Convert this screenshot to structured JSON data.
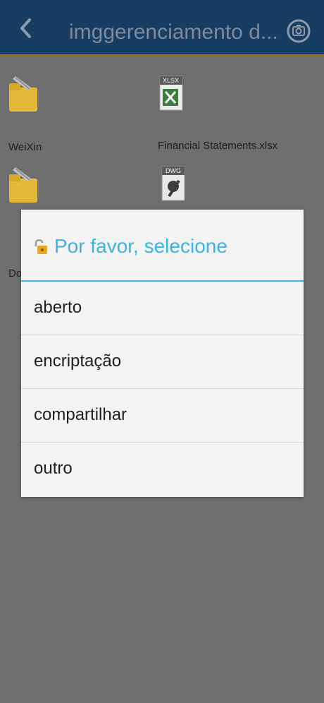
{
  "app_bar": {
    "title": "imggerenciamento d..."
  },
  "files": [
    {
      "name": "WeiXin",
      "icon": "folder-icon"
    },
    {
      "name": "Financial Statements.xlsx",
      "icon": "xlsx-file-icon",
      "badge": "XLSX"
    },
    {
      "name": "Do",
      "icon": "folder-icon"
    },
    {
      "name": "",
      "icon": "dwg-file-icon",
      "badge": "DWG"
    }
  ],
  "dialog": {
    "title": "Por favor, selecione",
    "options": [
      {
        "label": "aberto"
      },
      {
        "label": "encriptação"
      },
      {
        "label": "compartilhar"
      },
      {
        "label": "outro"
      }
    ]
  },
  "colors": {
    "app_bar": "#183d63",
    "app_bar_accent": "#a86b0e",
    "dialog_accent": "#38b5e5",
    "folder": "#e4b938"
  }
}
